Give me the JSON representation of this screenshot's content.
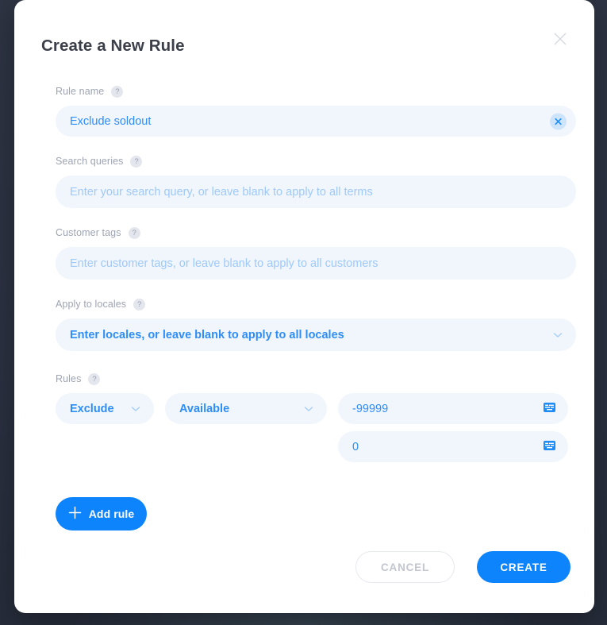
{
  "modal": {
    "title": "Create a New Rule",
    "close_icon": "close-icon"
  },
  "fields": {
    "rule_name": {
      "label": "Rule name",
      "help_icon": "?",
      "value": "Exclude soldout",
      "clear_icon": "×"
    },
    "search_queries": {
      "label": "Search queries",
      "help_icon": "?",
      "placeholder": "Enter your search query, or leave blank to apply to all terms"
    },
    "customer_tags": {
      "label": "Customer tags",
      "help_icon": "?",
      "placeholder": "Enter customer tags, or leave blank to apply to all customers"
    },
    "locales": {
      "label": "Apply to locales",
      "help_icon": "?",
      "value": "Enter locales, or leave blank to apply to all locales"
    }
  },
  "rules": {
    "label": "Rules",
    "help_icon": "?",
    "rows": [
      {
        "action": "Exclude",
        "condition": "Available",
        "min": "-99999",
        "max": "0"
      }
    ],
    "add_button": {
      "label": "Add rule",
      "icon": "plus-icon"
    }
  },
  "footer": {
    "cancel_label": "CANCEL",
    "create_label": "CREATE"
  },
  "colors": {
    "accent": "#0d84fb",
    "input_bg": "#f1f6fd",
    "input_text": "#2e8df7",
    "placeholder": "#9fc9f8",
    "label": "#9ea4b3",
    "backdrop": "#2b3242"
  }
}
